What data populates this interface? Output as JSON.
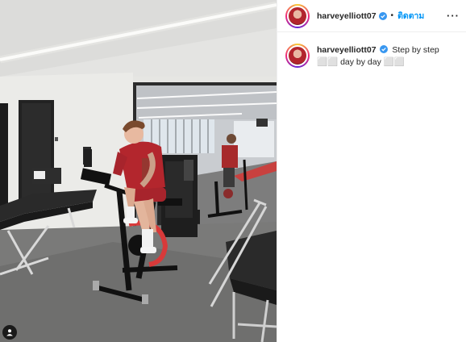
{
  "post": {
    "username": "harveyelliott07",
    "separator": "•",
    "follow_label": "ติดตาม",
    "more_label": "···",
    "caption_text": "Step by step ⬜⬜ day by day ⬜⬜",
    "caption_part1": "Step by step",
    "caption_emoji1": "⬜⬜",
    "caption_part2": "day by day",
    "caption_emoji2": "⬜⬜"
  },
  "icons": {
    "verified": "verified-badge-icon",
    "more": "more-options-icon",
    "tagged_user": "tagged-user-icon"
  },
  "colors": {
    "accent": "#0095f6",
    "text": "#262626",
    "bike_frame": "#111111",
    "shirt": "#b3262d"
  }
}
